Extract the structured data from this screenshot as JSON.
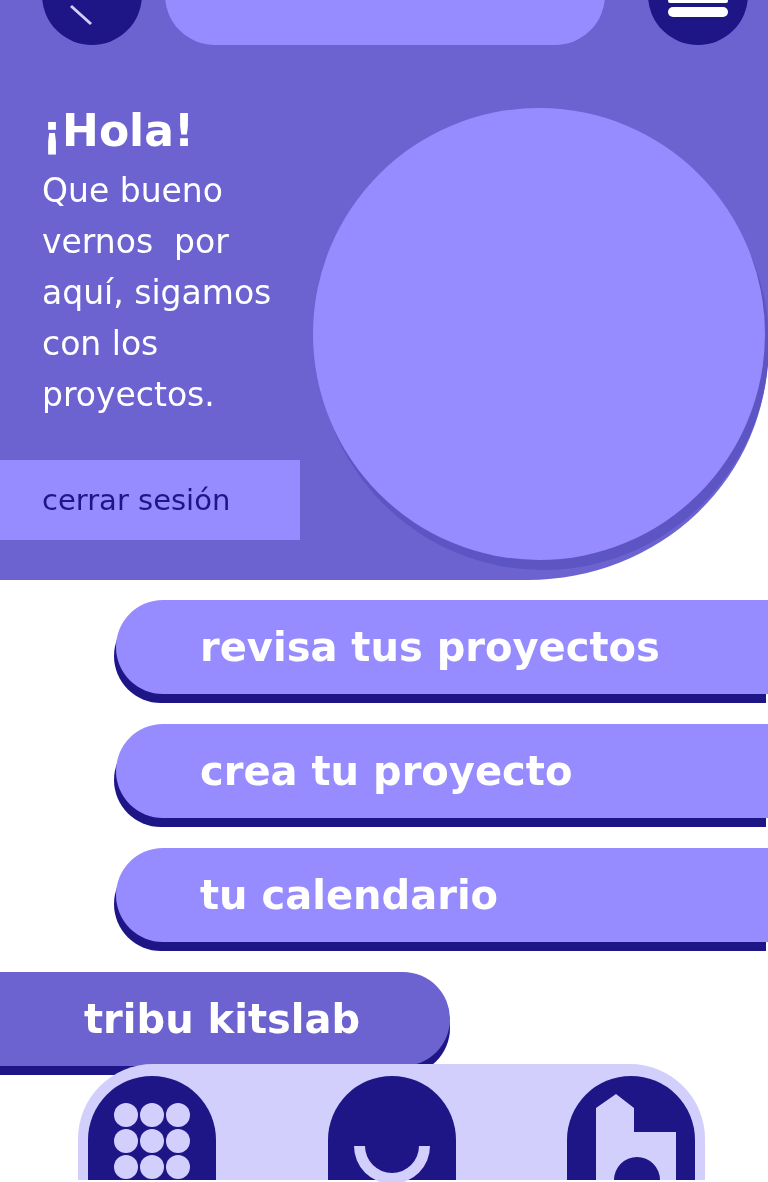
{
  "greeting": {
    "title": "¡Hola!",
    "message": "Que bueno vernos  por aquí, sigamos con los proyectos."
  },
  "logout": {
    "label": "cerrar sesión"
  },
  "menu": [
    {
      "label": "revisa tus proyectos",
      "kind": "primary"
    },
    {
      "label": "crea tu proyecto",
      "kind": "primary"
    },
    {
      "label": "tu calendario",
      "kind": "primary"
    },
    {
      "label": "tribu kitslab",
      "kind": "secondary"
    }
  ]
}
